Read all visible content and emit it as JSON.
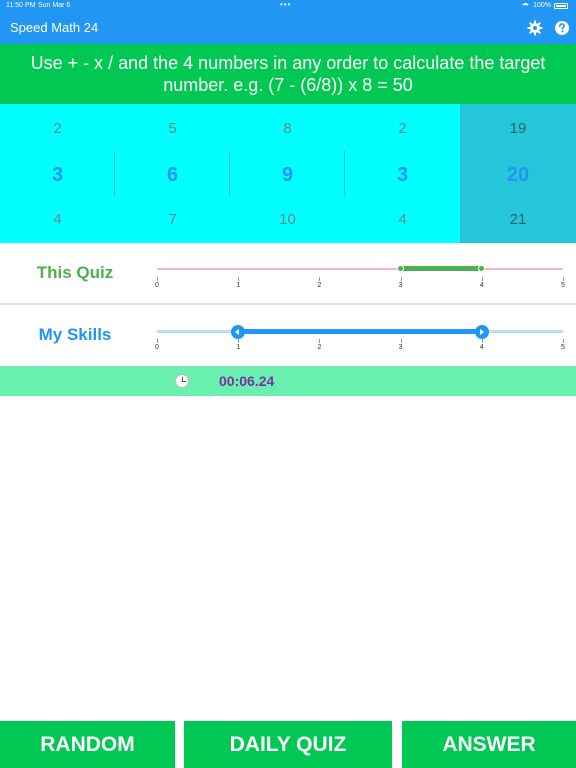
{
  "status_bar": {
    "time": "11:50 PM",
    "date": "Sun Mar 6",
    "battery": "100%",
    "dots": "•••"
  },
  "app_bar": {
    "title": "Speed Math 24",
    "settings_icon": "gear-icon",
    "help_icon": "help-icon"
  },
  "instruction": "Use + - x / and the 4 numbers in any order to calculate the target number.  e.g. (7 - (6/8)) x 8 = 50",
  "picker": {
    "columns": [
      {
        "prev": "2",
        "current": "3",
        "next": "4"
      },
      {
        "prev": "5",
        "current": "6",
        "next": "7"
      },
      {
        "prev": "8",
        "current": "9",
        "next": "10"
      },
      {
        "prev": "2",
        "current": "3",
        "next": "4"
      }
    ],
    "target": {
      "prev": "19",
      "current": "20",
      "next": "21"
    }
  },
  "sliders": {
    "ticks": [
      "0",
      "1",
      "2",
      "3",
      "4",
      "5"
    ],
    "this_quiz": {
      "label": "This Quiz",
      "low": 3,
      "high": 4,
      "min": 0,
      "max": 5
    },
    "my_skills": {
      "label": "My Skills",
      "low": 1,
      "high": 4,
      "min": 0,
      "max": 5
    }
  },
  "timer": {
    "value": "00:06.24",
    "icon": "clock-icon"
  },
  "buttons": {
    "random": "RANDOM",
    "daily_quiz": "DAILY QUIZ",
    "answer": "ANSWER"
  },
  "colors": {
    "app_bar": "#2196f3",
    "instruction_bg": "#00c853",
    "picker_bg": "#00ffff",
    "target_bg": "#26c6da",
    "timer_bg": "#69f0ae",
    "timer_text": "#7b2fa5",
    "this_quiz": "#4caf50",
    "my_skills": "#2196f3"
  }
}
